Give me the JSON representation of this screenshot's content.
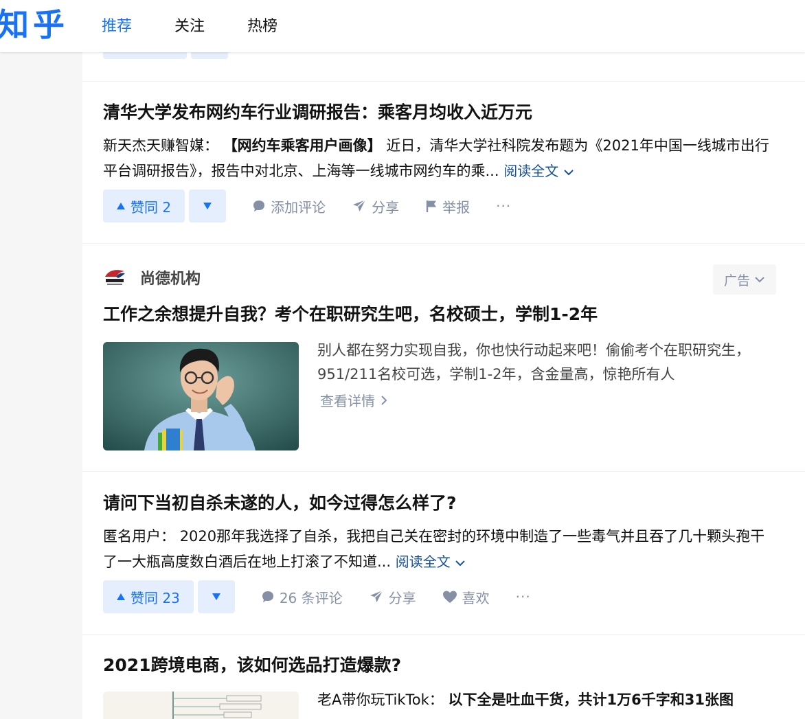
{
  "header": {
    "logo": "知乎",
    "tabs": [
      {
        "label": "推荐",
        "active": true
      },
      {
        "label": "关注",
        "active": false
      },
      {
        "label": "热榜",
        "active": false
      }
    ]
  },
  "colors": {
    "brand": "#1772f6",
    "vote_bg": "#e5eefc",
    "muted": "#8590a6",
    "link": "#175199"
  },
  "feed": [
    {
      "type": "article",
      "title": "清华大学发布网约车行业调研报告：乘客月均收入近万元",
      "author": "新天杰天赚智媒：",
      "bold_lead": "【网约车乘客用户画像】",
      "excerpt": "近日，清华大学社科院发布题为《2021年中国一线城市出行平台调研报告》，报告中对北京、上海等一线城市网约车的乘...",
      "read_more": "阅读全文",
      "actions": {
        "vote": "赞同 2",
        "comment": "添加评论",
        "share": "分享",
        "third": "举报",
        "more": "···"
      }
    },
    {
      "type": "ad",
      "brand": "尚德机构",
      "ad_tag": "广告",
      "title": "工作之余想提升自我？考个在职研究生吧，名校硕士，学制1-2年",
      "description": "别人都在努力实现自我，你也快行动起来吧！偷偷考个在职研究生，951/211名校可选，学制1-2年，含金量高，惊艳所有人",
      "link": "查看详情"
    },
    {
      "type": "answer",
      "title": "请问下当初自杀未遂的人，如今过得怎么样了?",
      "author": "匿名用户：",
      "excerpt": "2020那年我选择了自杀，我把自己关在密封的环境中制造了一些毒气并且吞了几十颗头孢干了一大瓶高度数白酒后在地上打滚了不知道...",
      "read_more": "阅读全文",
      "actions": {
        "vote": "赞同 23",
        "comment": "26 条评论",
        "share": "分享",
        "third": "喜欢",
        "more": "···"
      }
    },
    {
      "type": "article",
      "title": "2021跨境电商，该如何选品打造爆款?",
      "author": "老A带你玩TikTok：",
      "bold_lead": "以下全是吐血干货，共计1万6千字和31张图"
    }
  ]
}
